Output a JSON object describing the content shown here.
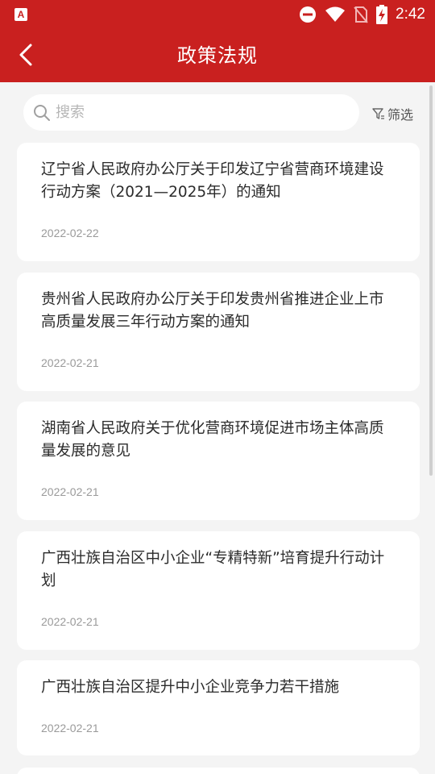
{
  "status_bar": {
    "app_icon": "A",
    "time": "2:42",
    "icons": [
      "do-not-disturb-icon",
      "wifi-icon",
      "no-sim-icon",
      "battery-charging-icon"
    ]
  },
  "header": {
    "title": "政策法规",
    "back_icon": "chevron-left-icon",
    "background_color": "#c9201f"
  },
  "search": {
    "placeholder": "搜索",
    "value": "",
    "filter_label": "筛选"
  },
  "policies": [
    {
      "title": "辽宁省人民政府办公厅关于印发辽宁省营商环境建设行动方案（2021—2025年）的通知",
      "date": "2022-02-22"
    },
    {
      "title": "贵州省人民政府办公厅关于印发贵州省推进企业上市高质量发展三年行动方案的通知",
      "date": "2022-02-21"
    },
    {
      "title": "湖南省人民政府关于优化营商环境促进市场主体高质量发展的意见",
      "date": "2022-02-21"
    },
    {
      "title": "广西壮族自治区中小企业“专精特新”培育提升行动计划",
      "date": "2022-02-21"
    },
    {
      "title": "广西壮族自治区提升中小企业竞争力若干措施",
      "date": "2022-02-21"
    }
  ]
}
